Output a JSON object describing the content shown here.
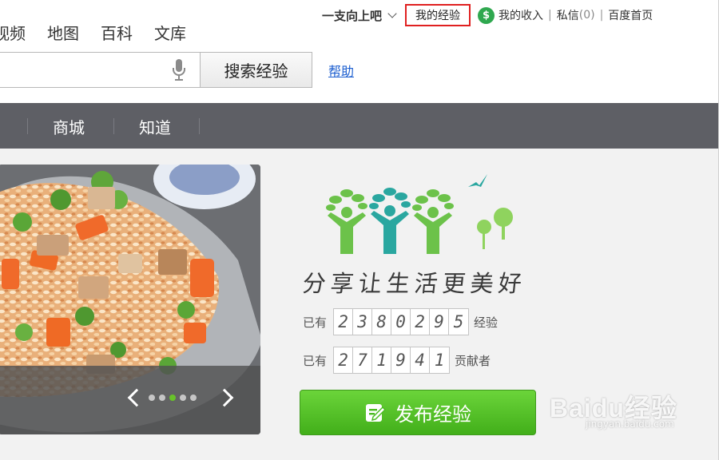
{
  "userbar": {
    "username": "一支向上吧",
    "my_experience": "我的经验",
    "coin_symbol": "$",
    "my_income": "我的收入",
    "separator": "|",
    "messages_label": "私信",
    "messages_count": "(0)",
    "baidu_home": "百度首页"
  },
  "channels": [
    "视频",
    "地图",
    "百科",
    "文库"
  ],
  "search": {
    "value": "",
    "placeholder": "",
    "button_label": "搜索经验",
    "help_label": "帮助"
  },
  "nav": [
    "商城",
    "知道"
  ],
  "banner": {
    "current_slide": 3,
    "slide_count": 5
  },
  "slogan": "分享让生活更美好",
  "stats": {
    "experiences_prefix": "已有",
    "experiences_digits": [
      "2",
      "3",
      "8",
      "0",
      "2",
      "9",
      "5"
    ],
    "experiences_suffix": "经验",
    "contributors_prefix": "已有",
    "contributors_digits": [
      "2",
      "7",
      "1",
      "9",
      "4",
      "1"
    ],
    "contributors_suffix": "贡献者"
  },
  "publish_button": "发布经验",
  "watermark": {
    "brand": "Baidu经验",
    "url": "jingyan.baidu.com"
  },
  "colors": {
    "highlight_border": "#e02020",
    "navbar": "#5e5f65",
    "publish_green": "#4cbb22",
    "logo_green": "#6cc24a",
    "logo_teal": "#2aa7a0",
    "link_blue": "#1d5fd0"
  },
  "icons": {
    "dropdown": "chevron-down-icon",
    "income": "dollar-coin-icon",
    "voice": "microphone-icon",
    "publish": "edit-note-icon",
    "prev": "chevron-left-icon",
    "next": "chevron-right-icon"
  }
}
